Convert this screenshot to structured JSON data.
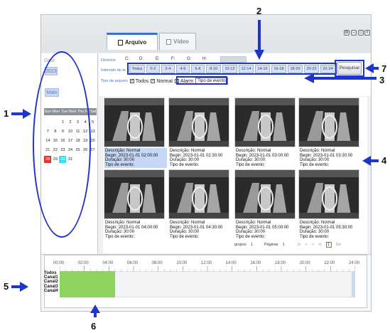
{
  "tabs": [
    {
      "label": "Arquivo",
      "active": true
    },
    {
      "label": "Vídeo",
      "active": false
    }
  ],
  "left_panel": {
    "date_label": "Data",
    "year": "2023",
    "month": "Maio",
    "weekdays": [
      "Sun",
      "Mon",
      "Tue",
      "Wed",
      "Thu",
      "Fri",
      "Sat"
    ],
    "weeks": [
      [
        "",
        "",
        "1",
        "2",
        "3",
        "4",
        "5"
      ],
      [
        "",
        "7",
        "8",
        "9",
        "10",
        "11",
        "12"
      ],
      [
        "13",
        "14",
        "15",
        "16",
        "17",
        "18",
        "19"
      ],
      [
        "20",
        "21",
        "22",
        "23",
        "24",
        "25",
        "26"
      ],
      [
        "27",
        "28",
        "29",
        "30",
        "31",
        "",
        ""
      ]
    ],
    "week_rows_display": [
      [
        "",
        "",
        "1",
        "2",
        "3",
        "4",
        "5"
      ],
      [
        "7",
        "8",
        "9",
        "10",
        "11",
        "12",
        "13"
      ],
      [
        "14",
        "15",
        "16",
        "17",
        "18",
        "19",
        "20"
      ],
      [
        "21",
        "22",
        "23",
        "24",
        "25",
        "26",
        "27"
      ],
      [
        "28",
        "29",
        "30",
        "31",
        "",
        "",
        ""
      ]
    ],
    "highlight_red": "28",
    "highlight_cyan": "30"
  },
  "toolbar": {
    "directory_label": "Diretório",
    "drives": [
      "C:",
      "D:",
      "E:",
      "F:",
      "G:",
      "H:"
    ],
    "interval_label": "Intervalo de te",
    "hours": [
      "Todos",
      "0-2",
      "2-4",
      "4-6",
      "6-8",
      "8-10",
      "10-12",
      "12-14",
      "14-16",
      "16-18",
      "18-20",
      "20-22",
      "22-24"
    ],
    "file_type_label": "Tipo de arquivo",
    "file_types": [
      "Todos",
      "Normal",
      "Alarm"
    ],
    "event_type_placeholder": "Tipo de evento",
    "search_label": "Pesquisar"
  },
  "records": [
    {
      "desc": "Descrição: Normal",
      "begin": "Begin: 2023-01-01 02:00:00",
      "duration": "Duração: 30:00",
      "event": "Tipo de evento:",
      "selected": true
    },
    {
      "desc": "Descrição: Normal",
      "begin": "Begin: 2023-01-01 02:30:00",
      "duration": "Duração: 30:00",
      "event": "Tipo de evento:",
      "selected": false
    },
    {
      "desc": "Descrição: Normal",
      "begin": "Begin: 2023-01-01 03:00:00",
      "duration": "Duração: 30:00",
      "event": "Tipo de evento:",
      "selected": false
    },
    {
      "desc": "Descrição: Normal",
      "begin": "Begin: 2023-01-01 03:30:00",
      "duration": "Duração: 30:00",
      "event": "Tipo de evento:",
      "selected": false
    },
    {
      "desc": "Descrição: Normal",
      "begin": "Begin: 2023-01-01 04:00:00",
      "duration": "Duração: 30:00",
      "event": "Tipo de evento:",
      "selected": false
    },
    {
      "desc": "Descrição: Normal",
      "begin": "Begin: 2023-01-01 04:30:00",
      "duration": "Duração: 30:00",
      "event": "Tipo de evento:",
      "selected": false
    },
    {
      "desc": "Descrição: Normal",
      "begin": "Begin: 2023-01-01 05:00:00",
      "duration": "Duração: 30:00",
      "event": "Tipo de evento:",
      "selected": false
    },
    {
      "desc": "Descrição: Normal",
      "begin": "Begin: 2023-01-01 05:30:00",
      "duration": "Duração: 30:00",
      "event": "Tipo de evento:",
      "selected": false
    }
  ],
  "pager": {
    "groups_label": "grupos",
    "groups_value": "1",
    "pages_label": "Páginas",
    "pages_value": "1",
    "first": "|<",
    "prev": "<",
    "next": ">",
    "last": ">|",
    "page_input": "1",
    "go": "Go"
  },
  "timeline": {
    "ticks": [
      "00:00",
      "02:00",
      "04:00",
      "06:00",
      "08:00",
      "10:00",
      "12:00",
      "14:00",
      "16:00",
      "18:00",
      "20:00",
      "22:00",
      "24:00"
    ],
    "channels": [
      "Todos",
      "Canal1",
      "Canal2",
      "Canal3",
      "Canal4"
    ],
    "recorded_from_hour": 0,
    "recorded_to_hour": 4.5,
    "bar_color": "#8dd35f"
  },
  "callouts": [
    "1",
    "2",
    "3",
    "4",
    "5",
    "6",
    "7"
  ],
  "colors": {
    "accent": "#1f35c9",
    "chip": "#c9d8f4",
    "selected_row": "#c6d6f5"
  }
}
